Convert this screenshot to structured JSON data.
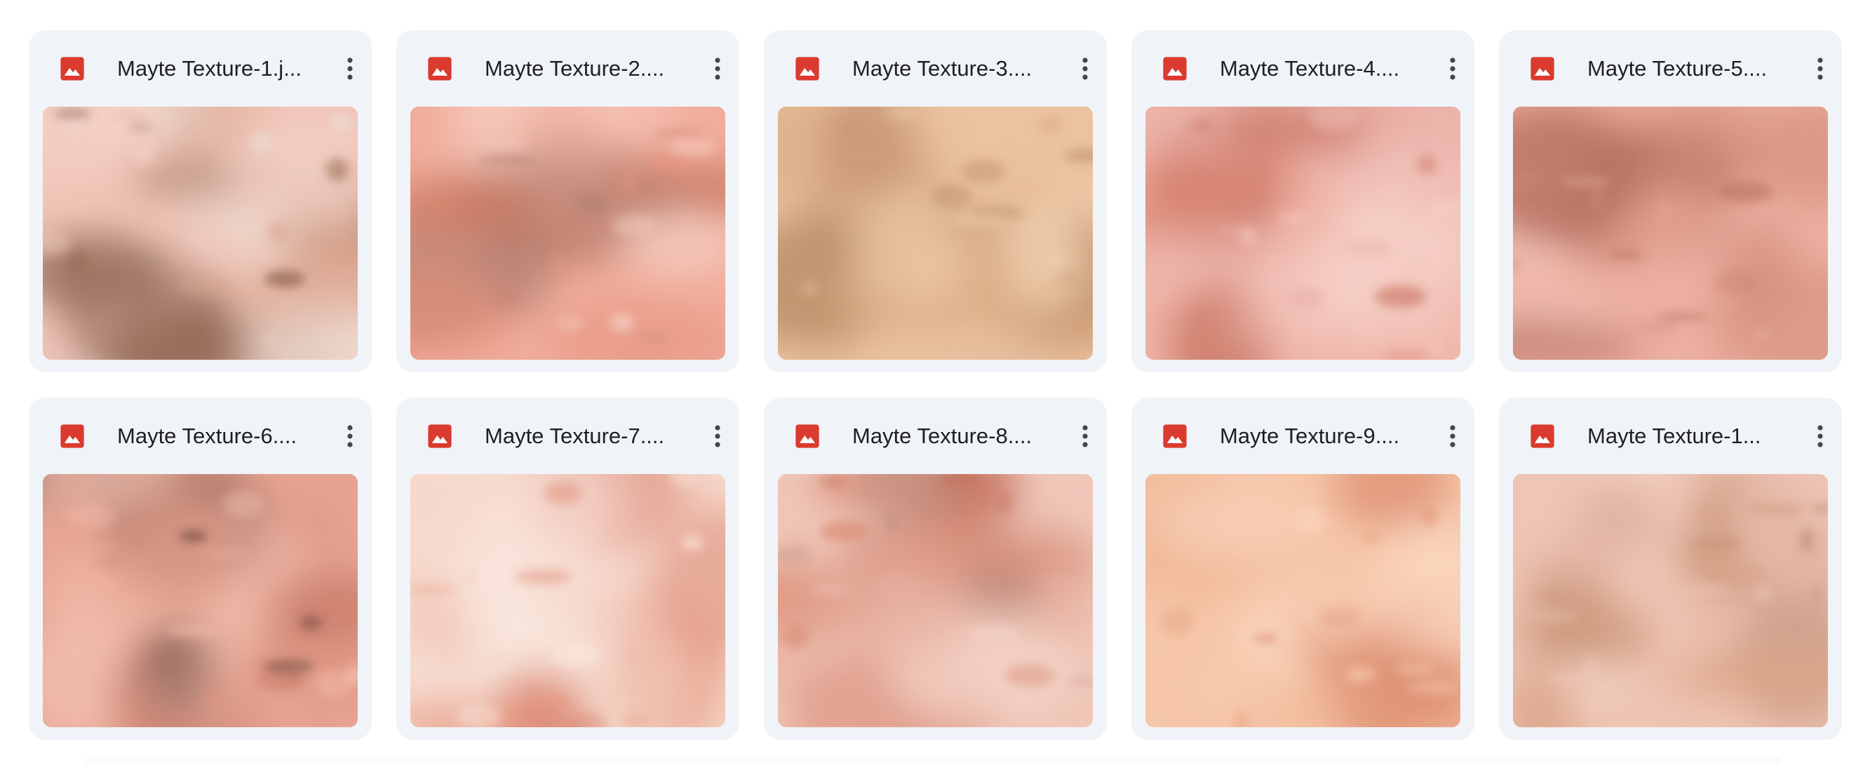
{
  "colors": {
    "card_background": "#f0f4f9",
    "file_icon": "#db3a2e",
    "text": "#1f1f1f",
    "menu_icon": "#444746"
  },
  "icons": {
    "file_type": "image-file-icon",
    "menu": "more-vert-icon"
  },
  "files": [
    {
      "name": "Mayte Texture-1.jpg",
      "display_name": "Mayte Texture-1.j...",
      "thumbnail": {
        "base": "#efc4b6",
        "tones": [
          "#f4cec2",
          "#a97a63",
          "#ece2da",
          "#d9a58f",
          "#8d6450"
        ]
      }
    },
    {
      "name": "Mayte Texture-2.jpg",
      "display_name": "Mayte Texture-2....",
      "thumbnail": {
        "base": "#f1ad9b",
        "tones": [
          "#c97b63",
          "#f7c8bb",
          "#e59580",
          "#b28275",
          "#f5d0c4"
        ]
      }
    },
    {
      "name": "Mayte Texture-3.jpg",
      "display_name": "Mayte Texture-3....",
      "thumbnail": {
        "base": "#ebc39f",
        "tones": [
          "#f2d2b2",
          "#d5a27c",
          "#b58762",
          "#e6b993",
          "#c99775"
        ]
      }
    },
    {
      "name": "Mayte Texture-4.jpg",
      "display_name": "Mayte Texture-4....",
      "thumbnail": {
        "base": "#f0b5a9",
        "tones": [
          "#f7d5cd",
          "#d98671",
          "#eab3ab",
          "#c56e5a",
          "#f4c9bf"
        ]
      }
    },
    {
      "name": "Mayte Texture-5.jpg",
      "display_name": "Mayte Texture-5....",
      "thumbnail": {
        "base": "#edb0a1",
        "tones": [
          "#d5907e",
          "#f5c8bd",
          "#c98472",
          "#e7a696",
          "#b7705f"
        ]
      }
    },
    {
      "name": "Mayte Texture-6.jpg",
      "display_name": "Mayte Texture-6....",
      "thumbnail": {
        "base": "#e7a492",
        "tones": [
          "#f3c2b2",
          "#c97d6b",
          "#dd9580",
          "#5a3a34",
          "#f0b8a6"
        ]
      }
    },
    {
      "name": "Mayte Texture-7.jpg",
      "display_name": "Mayte Texture-7....",
      "thumbnail": {
        "base": "#f6d8cc",
        "tones": [
          "#fae8e0",
          "#efbfae",
          "#e69b82",
          "#f7dbd0",
          "#d9826c"
        ]
      }
    },
    {
      "name": "Mayte Texture-8.jpg",
      "display_name": "Mayte Texture-8....",
      "thumbnail": {
        "base": "#efc6b8",
        "tones": [
          "#d98a72",
          "#f4d6ca",
          "#c2705a",
          "#e9b3a3",
          "#b98d80"
        ]
      }
    },
    {
      "name": "Mayte Texture-9.jpg",
      "display_name": "Mayte Texture-9....",
      "thumbnail": {
        "base": "#f6c6a8",
        "tones": [
          "#fad6bf",
          "#efb594",
          "#e2987a",
          "#f7cdb2",
          "#d9886b"
        ]
      }
    },
    {
      "name": "Mayte Texture-10.jpg",
      "display_name": "Mayte Texture-1...",
      "thumbnail": {
        "base": "#eec4b3",
        "tones": [
          "#c99477",
          "#f4d8c7",
          "#dba488",
          "#b8856c",
          "#f0c6ba"
        ]
      }
    }
  ]
}
